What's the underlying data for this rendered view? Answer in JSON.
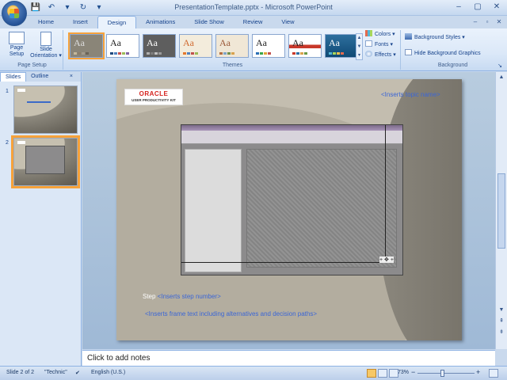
{
  "window": {
    "title": "PresentationTemplate.pptx - Microsoft PowerPoint",
    "controls": [
      "–",
      "▢",
      "✕"
    ],
    "doc_controls": [
      "–",
      "▫",
      "✕"
    ]
  },
  "quick_access": [
    "💾",
    "↶",
    "▾",
    "↻",
    "▾"
  ],
  "tabs": [
    "Home",
    "Insert",
    "Design",
    "Animations",
    "Slide Show",
    "Review",
    "View"
  ],
  "active_tab": "Design",
  "ribbon": {
    "page_setup": {
      "label": "Page Setup",
      "page_setup_btn": "Page Setup",
      "orientation_btn": "Slide Orientation ▾"
    },
    "themes": {
      "label": "Themes",
      "sample_text": "Aa",
      "colors": "Colors ▾",
      "fonts": "Fonts ▾",
      "effects": "Effects ▾"
    },
    "background": {
      "label": "Background",
      "styles": "Background Styles ▾",
      "hide_graphics": "Hide Background Graphics",
      "launcher": "↘"
    }
  },
  "left_panel": {
    "tabs": [
      "Slides",
      "Outline"
    ],
    "close": "×",
    "slide_numbers": [
      "1",
      "2"
    ]
  },
  "slide": {
    "logo_text": "ORACLE",
    "logo_sub": "USER PRODUCTIVITY KIT",
    "topic": "<Inserts topic name>",
    "step_word": "Step",
    "step_number": "<Inserts step number>",
    "frame_text": "<Inserts frame text including alternatives and decision paths>",
    "handles": "+ ✥ +"
  },
  "notes_placeholder": "Click to add notes",
  "status": {
    "slide_info": "Slide 2 of 2",
    "theme": "\"Technic\"",
    "check_icon": "✔",
    "language": "English (U.S.)",
    "zoom": "73%",
    "zoom_minus": "−",
    "zoom_plus": "+"
  },
  "colors": {
    "accent": "#f6a23a",
    "ribbon_bg": "#dbe8f8",
    "slide_bg": "#bab4a6",
    "placeholder_text": "#3b66d6"
  }
}
